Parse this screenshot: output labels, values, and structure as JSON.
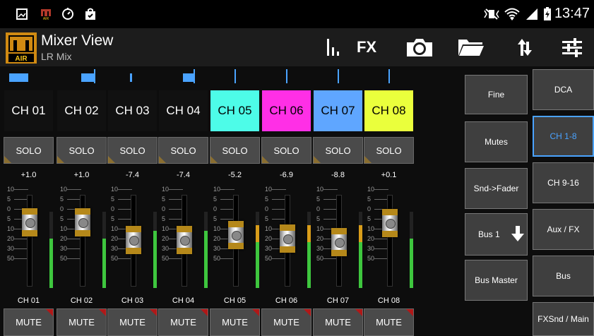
{
  "status_bar": {
    "time": "13:47",
    "icons": [
      "gallery-icon",
      "air-notification-icon",
      "sync-icon",
      "shopping-bag-icon",
      "mute-vibrate-icon",
      "wifi-icon",
      "signal-icon",
      "battery-charging-icon"
    ]
  },
  "header": {
    "title": "Mixer View",
    "subtitle": "LR Mix",
    "logo_text": "AIR",
    "toolbar": {
      "meters_icon": "meters-icon",
      "fx_label": "FX",
      "snapshot_icon": "camera-icon",
      "folder_icon": "folder-icon",
      "sync_icon": "up-down-arrows-icon",
      "settings_icon": "sliders-icon"
    }
  },
  "channels": [
    {
      "name": "CH 01",
      "label": "CH 01",
      "gain": "+1.0",
      "solo": "SOLO",
      "mute": "MUTE",
      "color": "",
      "pan": -0.8,
      "fader": 0.75,
      "meter": 0.65,
      "peak": null
    },
    {
      "name": "CH 02",
      "label": "CH 02",
      "gain": "+1.0",
      "solo": "SOLO",
      "mute": "MUTE",
      "color": "",
      "pan": 0.6,
      "fader": 0.75,
      "meter": 0.65,
      "peak": null
    },
    {
      "name": "CH 03",
      "label": "CH 03",
      "gain": "-7.4",
      "solo": "SOLO",
      "mute": "MUTE",
      "color": "",
      "pan": -0.1,
      "fader": 0.5,
      "meter": 0.75,
      "peak": null
    },
    {
      "name": "CH 04",
      "label": "CH 04",
      "gain": "-7.4",
      "solo": "SOLO",
      "mute": "MUTE",
      "color": "",
      "pan": 0.5,
      "fader": 0.5,
      "meter": 0.75,
      "peak": null
    },
    {
      "name": "CH 05",
      "label": "CH 05",
      "gain": "-5.2",
      "solo": "SOLO",
      "mute": "MUTE",
      "color": "#4dfce8",
      "pan": 0.0,
      "fader": 0.57,
      "meter": 0.6,
      "peak": 0.82
    },
    {
      "name": "CH 06",
      "label": "CH 06",
      "gain": "-6.9",
      "solo": "SOLO",
      "mute": "MUTE",
      "color": "#ff2fe6",
      "pan": 0.0,
      "fader": 0.52,
      "meter": 0.72,
      "peak": 0.82
    },
    {
      "name": "CH 07",
      "label": "CH 07",
      "gain": "-8.8",
      "solo": "SOLO",
      "mute": "MUTE",
      "color": "#5fa6ff",
      "pan": 0.0,
      "fader": 0.47,
      "meter": 0.72,
      "peak": 0.82
    },
    {
      "name": "CH 08",
      "label": "CH 08",
      "gain": "+0.1",
      "solo": "SOLO",
      "mute": "MUTE",
      "color": "#eaff3c",
      "pan": 0.0,
      "fader": 0.74,
      "meter": 0.65,
      "peak": null
    }
  ],
  "scale_labels": [
    "10",
    "5",
    "0",
    "5",
    "10",
    "20",
    "30",
    "50"
  ],
  "side_left": [
    "Fine",
    "Mutes",
    "Snd->Fader",
    "Bus 1",
    "Bus Master"
  ],
  "side_right": [
    "DCA",
    "CH 1-8",
    "CH 9-16",
    "Aux / FX",
    "Bus",
    "FXSnd / Main"
  ],
  "selected_group": "CH 1-8"
}
